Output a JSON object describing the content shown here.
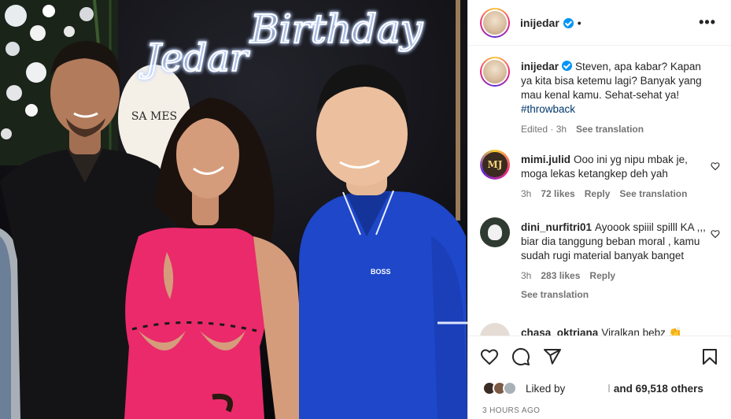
{
  "post": {
    "username": "inijedar",
    "verified": true,
    "header_separator": "•",
    "more_icon": "more-horizontal-icon"
  },
  "photo": {
    "neon_sign": [
      "Jedar",
      "Birthday"
    ],
    "backdrop_sign": "SA MES",
    "shirt_logo": "BOSS"
  },
  "caption": {
    "username": "inijedar",
    "text": "Steven, apa kabar? Kapan ya kita bisa ketemu lagi? Banyak yang mau kenal kamu. Sehat-sehat ya!",
    "hashtag": "#throwback",
    "time": "Edited · 3h",
    "see_translation": "See translation"
  },
  "comments": [
    {
      "username": "mimi.julid",
      "avatar_text": "MJ",
      "text": "Ooo ini yg nipu mbak je, moga lekas ketangkep deh yah",
      "time": "3h",
      "likes": "72 likes",
      "reply": "Reply",
      "see_translation": "See translation"
    },
    {
      "username": "dini_nurfitri01",
      "text": "Ayoook spiiil spilll KA ,,, biar dia tanggung beban moral , kamu sudah rugi material banyak banget",
      "time": "3h",
      "likes": "283 likes",
      "reply": "Reply",
      "see_translation": "See translation"
    },
    {
      "username": "chasa_oktriana",
      "text": "Viralkan bebz 👏"
    }
  ],
  "actions": {
    "like_icon": "heart-icon",
    "comment_icon": "comment-icon",
    "share_icon": "paper-plane-icon",
    "save_icon": "bookmark-icon"
  },
  "likes": {
    "liked_by": "Liked by",
    "and_others": "and 69,518 others",
    "separator": "ǀ"
  },
  "timestamp": "3 HOURS AGO",
  "colors": {
    "verified": "#0095f6",
    "hashtag": "#00376b",
    "muted": "#737373",
    "dress": "#ea2a6b",
    "shirt": "#1e47c9"
  }
}
